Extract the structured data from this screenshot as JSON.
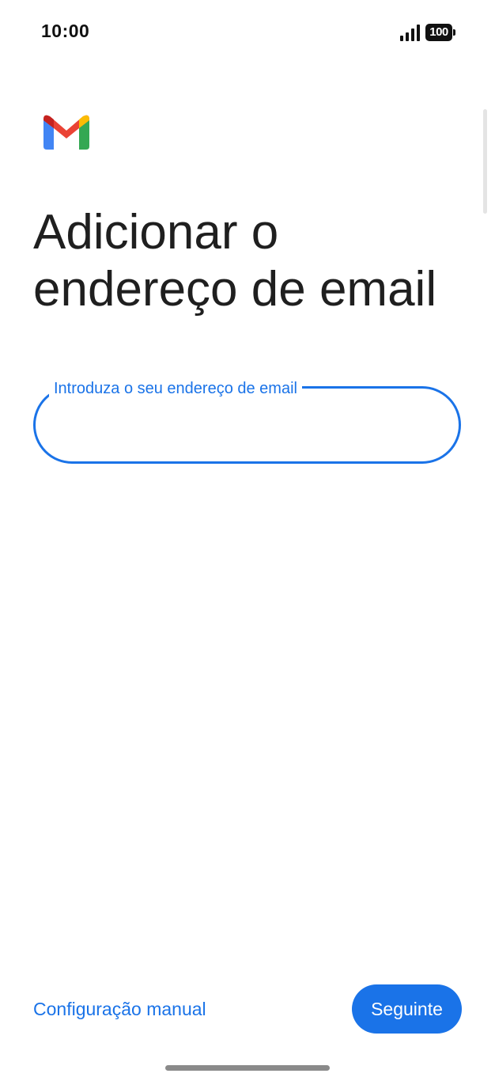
{
  "status_bar": {
    "time": "10:00",
    "battery": "100",
    "signal_icon": "signal-icon",
    "battery_icon": "battery-icon"
  },
  "logo": {
    "name": "gmail-logo",
    "colors": [
      "#4285F4",
      "#EA4335",
      "#FBBC04",
      "#34A853",
      "#C5221F"
    ]
  },
  "page": {
    "title": "Adicionar o endereço de email"
  },
  "email": {
    "label": "Introduza o seu endereço de email",
    "value": "",
    "placeholder": ""
  },
  "actions": {
    "manual_setup_label": "Configuração manual",
    "next_label": "Seguinte"
  },
  "colors": {
    "accent": "#1a73e8",
    "title_text": "#1f1f1f",
    "background": "#ffffff"
  }
}
